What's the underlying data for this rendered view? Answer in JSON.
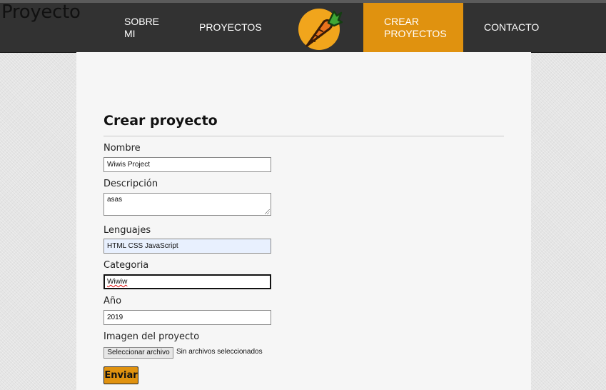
{
  "header": {
    "brand": "Proyecto",
    "logo_icon": "carrot-icon",
    "nav": {
      "sobre_mi_line1": "SOBRE",
      "sobre_mi_line2": "MI",
      "proyectos": "PROYECTOS",
      "crear_line1": "CREAR",
      "crear_line2": "PROYECTOS",
      "contacto": "CONTACTO"
    },
    "active_color": "#e0920f",
    "bar_color": "#323232"
  },
  "form": {
    "title": "Crear proyecto",
    "nombre_label": "Nombre",
    "nombre_value": "Wiwis Project",
    "descripcion_label": "Descripción",
    "descripcion_value": "asas",
    "lenguajes_label": "Lenguajes",
    "lenguajes_value": "HTML  CSS  JavaScript",
    "categoria_label": "Categoria",
    "categoria_value": "Wiwiw",
    "anio_label": "Año",
    "anio_value": "2019",
    "imagen_label": "Imagen del proyecto",
    "file_button_label": "Seleccionar archivo",
    "file_status": "Sin archivos seleccionados",
    "submit_label": "Enviar"
  }
}
